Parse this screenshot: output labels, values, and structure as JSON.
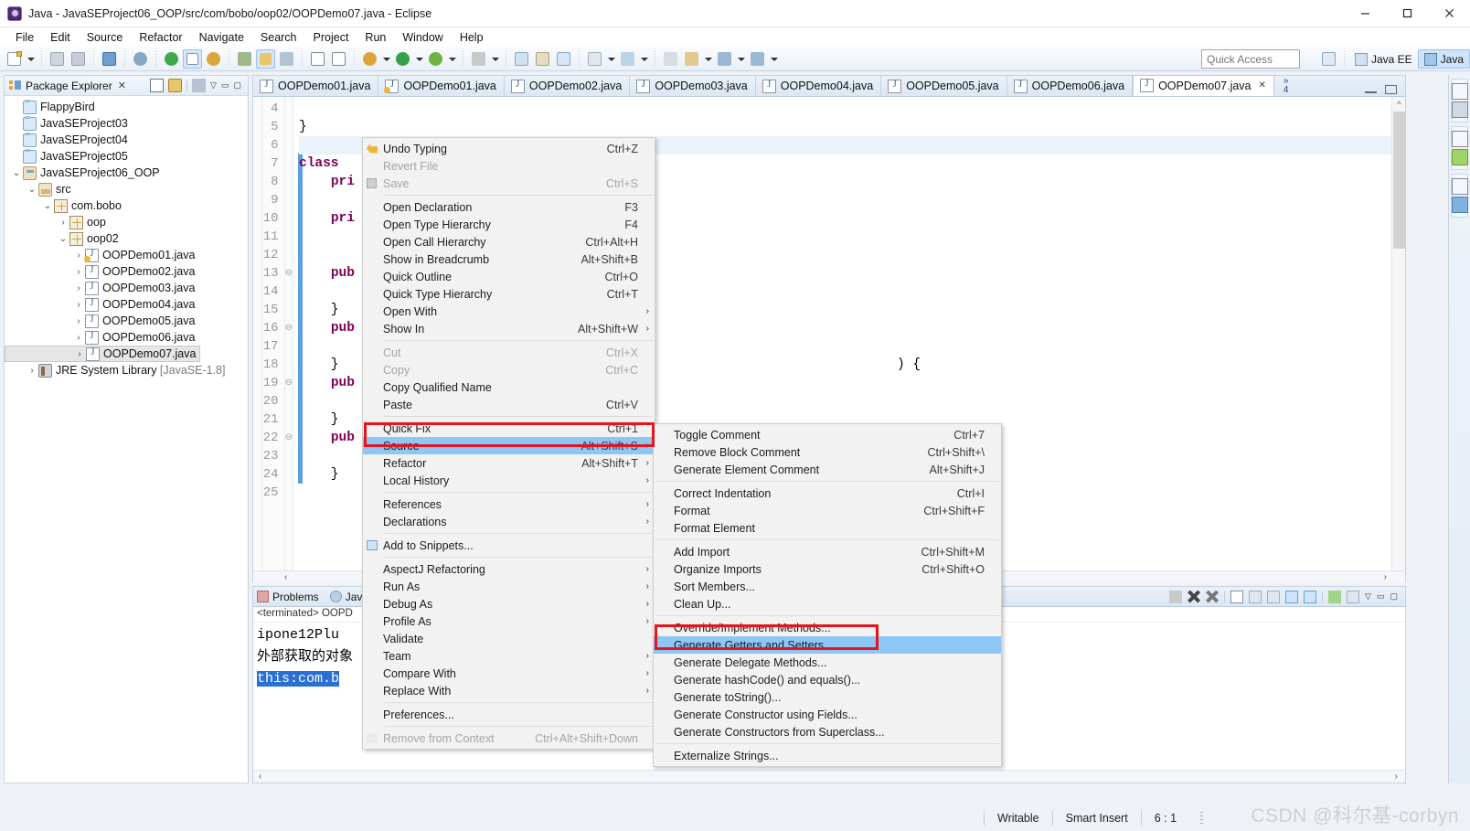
{
  "window": {
    "title": "Java - JavaSEProject06_OOP/src/com/bobo/oop02/OOPDemo07.java - Eclipse",
    "app_icon": "eclipse-icon",
    "minimize": "–",
    "maximize": "▢",
    "close": "✕"
  },
  "menubar": {
    "items": [
      "File",
      "Edit",
      "Source",
      "Refactor",
      "Navigate",
      "Search",
      "Project",
      "Run",
      "Window",
      "Help"
    ]
  },
  "toolbar": {
    "quick_access_placeholder": "Quick Access",
    "perspectives": [
      {
        "label": "Java EE",
        "selected": false
      },
      {
        "label": "Java",
        "selected": true
      }
    ]
  },
  "package_explorer": {
    "title": "Package Explorer",
    "close_glyph": "✕",
    "tools": [
      "collapse-all-icon",
      "link-with-editor-icon",
      "view-menu-icon",
      "minimize-icon",
      "maximize-icon"
    ],
    "tree": [
      {
        "label": "FlappyBird",
        "indent": 0,
        "twisty": "",
        "icon": "folder",
        "selected": false
      },
      {
        "label": "JavaSEProject03",
        "indent": 0,
        "twisty": "",
        "icon": "folder",
        "selected": false
      },
      {
        "label": "JavaSEProject04",
        "indent": 0,
        "twisty": "",
        "icon": "folder",
        "selected": false
      },
      {
        "label": "JavaSEProject05",
        "indent": 0,
        "twisty": "",
        "icon": "folder",
        "selected": false
      },
      {
        "label": "JavaSEProject06_OOP",
        "indent": 0,
        "twisty": "v",
        "icon": "project",
        "selected": false
      },
      {
        "label": "src",
        "indent": 1,
        "twisty": "v",
        "icon": "src",
        "selected": false
      },
      {
        "label": "com.bobo",
        "indent": 2,
        "twisty": "v",
        "icon": "pkg",
        "selected": false
      },
      {
        "label": "oop",
        "indent": 3,
        "twisty": ">",
        "icon": "pkg",
        "selected": false
      },
      {
        "label": "oop02",
        "indent": 3,
        "twisty": "v",
        "icon": "pkg",
        "selected": false
      },
      {
        "label": "OOPDemo01.java",
        "indent": 4,
        "twisty": ">",
        "icon": "java-warn",
        "selected": false
      },
      {
        "label": "OOPDemo02.java",
        "indent": 4,
        "twisty": ">",
        "icon": "java",
        "selected": false
      },
      {
        "label": "OOPDemo03.java",
        "indent": 4,
        "twisty": ">",
        "icon": "java",
        "selected": false
      },
      {
        "label": "OOPDemo04.java",
        "indent": 4,
        "twisty": ">",
        "icon": "java",
        "selected": false
      },
      {
        "label": "OOPDemo05.java",
        "indent": 4,
        "twisty": ">",
        "icon": "java",
        "selected": false
      },
      {
        "label": "OOPDemo06.java",
        "indent": 4,
        "twisty": ">",
        "icon": "java",
        "selected": false
      },
      {
        "label": "OOPDemo07.java",
        "indent": 4,
        "twisty": ">",
        "icon": "java",
        "selected": true
      },
      {
        "label": "JRE System Library [JavaSE-1.8]",
        "indent": 1,
        "twisty": ">",
        "icon": "library",
        "selected": false
      }
    ]
  },
  "editor": {
    "tabs": [
      {
        "label": "OOPDemo01.java",
        "icon": "java",
        "active": false,
        "dirty": false
      },
      {
        "label": "OOPDemo01.java",
        "icon": "java-warn",
        "active": false,
        "dirty": false
      },
      {
        "label": "OOPDemo02.java",
        "icon": "java",
        "active": false,
        "dirty": false
      },
      {
        "label": "OOPDemo03.java",
        "icon": "java",
        "active": false,
        "dirty": false
      },
      {
        "label": "OOPDemo04.java",
        "icon": "java",
        "active": false,
        "dirty": false
      },
      {
        "label": "OOPDemo05.java",
        "icon": "java",
        "active": false,
        "dirty": false
      },
      {
        "label": "OOPDemo06.java",
        "icon": "java",
        "active": false,
        "dirty": false
      },
      {
        "label": "OOPDemo07.java",
        "icon": "java",
        "active": true,
        "dirty": false
      }
    ],
    "active_tab_close": "✕",
    "overflow_chevron": "»",
    "overflow_count": "4",
    "minimize_tooltip": "Minimize",
    "maximize_tooltip": "Maximize",
    "lines": [
      {
        "no": "4",
        "fold": "",
        "text": ""
      },
      {
        "no": "5",
        "fold": "",
        "text": "}"
      },
      {
        "no": "6",
        "fold": "",
        "text": "",
        "current": true
      },
      {
        "no": "7",
        "fold": "",
        "text": "class P",
        "kw": "class"
      },
      {
        "no": "8",
        "fold": "",
        "text": "    pri",
        "kw": "pri"
      },
      {
        "no": "9",
        "fold": "",
        "text": ""
      },
      {
        "no": "10",
        "fold": "",
        "text": "    pri",
        "kw": "pri"
      },
      {
        "no": "11",
        "fold": "",
        "text": ""
      },
      {
        "no": "12",
        "fold": "",
        "text": ""
      },
      {
        "no": "13",
        "fold": "⊖",
        "text": "    pub",
        "kw": "pub"
      },
      {
        "no": "14",
        "fold": "",
        "text": ""
      },
      {
        "no": "15",
        "fold": "",
        "text": "    }"
      },
      {
        "no": "16",
        "fold": "⊖",
        "text": "    pub",
        "kw": "pub"
      },
      {
        "no": "17",
        "fold": "",
        "text": ""
      },
      {
        "no": "18",
        "fold": "",
        "text": "    }"
      },
      {
        "no": "19",
        "fold": "⊖",
        "text": "    pub",
        "kw": "pub"
      },
      {
        "no": "20",
        "fold": "",
        "text": ""
      },
      {
        "no": "21",
        "fold": "",
        "text": "    }"
      },
      {
        "no": "22",
        "fold": "⊖",
        "text": "    pub",
        "kw": "pub"
      },
      {
        "no": "23",
        "fold": "",
        "text": ""
      },
      {
        "no": "24",
        "fold": "",
        "text": "    }"
      },
      {
        "no": "25",
        "fold": "",
        "text": ""
      }
    ],
    "code_fragment_right": ") {",
    "scroll_up_glyph": "^",
    "scroll_down_glyph": "v",
    "hscroll_left_glyph": "‹",
    "hscroll_right_glyph": "›"
  },
  "console": {
    "tabs": [
      {
        "label": "Problems",
        "icon": "problems-icon",
        "active": false
      },
      {
        "label": "Javad",
        "icon": "javadoc-icon",
        "active": false
      }
    ],
    "terminated_line": "<terminated> OOPD",
    "output": [
      {
        "text": "ipone12Plu",
        "highlight": false
      },
      {
        "text": "外部获取的对象",
        "highlight": false
      },
      {
        "text": "this:com.b",
        "highlight": true
      }
    ],
    "tools": [
      "terminate-icon",
      "remove-launch-icon",
      "remove-all-icon",
      "open-console-icon",
      "display-selected-console-icon",
      "pin-console-icon",
      "scroll-lock-icon",
      "word-wrap-icon",
      "clear-console-icon",
      "view-menu-icon",
      "minimize-icon",
      "maximize-icon"
    ]
  },
  "statusbar": {
    "writable": "Writable",
    "insert_mode": "Smart Insert",
    "cursor_position": "6 : 1",
    "watermark": "CSDN @科尔基-corbyn"
  },
  "context_menu": {
    "items": [
      {
        "label": "Undo Typing",
        "accel": "Ctrl+Z",
        "icon": "undo-icon",
        "disabled": false,
        "submenu": false
      },
      {
        "label": "Revert File",
        "accel": "",
        "icon": "",
        "disabled": true,
        "submenu": false
      },
      {
        "label": "Save",
        "accel": "Ctrl+S",
        "icon": "save-icon",
        "disabled": true,
        "submenu": false
      },
      {
        "separator": true
      },
      {
        "label": "Open Declaration",
        "accel": "F3",
        "icon": "",
        "disabled": false,
        "submenu": false
      },
      {
        "label": "Open Type Hierarchy",
        "accel": "F4",
        "icon": "",
        "disabled": false,
        "submenu": false
      },
      {
        "label": "Open Call Hierarchy",
        "accel": "Ctrl+Alt+H",
        "icon": "",
        "disabled": false,
        "submenu": false
      },
      {
        "label": "Show in Breadcrumb",
        "accel": "Alt+Shift+B",
        "icon": "",
        "disabled": false,
        "submenu": false
      },
      {
        "label": "Quick Outline",
        "accel": "Ctrl+O",
        "icon": "",
        "disabled": false,
        "submenu": false
      },
      {
        "label": "Quick Type Hierarchy",
        "accel": "Ctrl+T",
        "icon": "",
        "disabled": false,
        "submenu": false
      },
      {
        "label": "Open With",
        "accel": "",
        "icon": "",
        "disabled": false,
        "submenu": true
      },
      {
        "label": "Show In",
        "accel": "Alt+Shift+W",
        "icon": "",
        "disabled": false,
        "submenu": true
      },
      {
        "separator": true
      },
      {
        "label": "Cut",
        "accel": "Ctrl+X",
        "icon": "",
        "disabled": true,
        "submenu": false
      },
      {
        "label": "Copy",
        "accel": "Ctrl+C",
        "icon": "",
        "disabled": true,
        "submenu": false
      },
      {
        "label": "Copy Qualified Name",
        "accel": "",
        "icon": "",
        "disabled": false,
        "submenu": false
      },
      {
        "label": "Paste",
        "accel": "Ctrl+V",
        "icon": "",
        "disabled": false,
        "submenu": false
      },
      {
        "separator": true
      },
      {
        "label": "Quick Fix",
        "accel": "Ctrl+1",
        "icon": "",
        "disabled": false,
        "submenu": false
      },
      {
        "label": "Source",
        "accel": "Alt+Shift+S",
        "icon": "",
        "disabled": false,
        "submenu": true,
        "selected": true,
        "highlighted_box": true
      },
      {
        "label": "Refactor",
        "accel": "Alt+Shift+T",
        "icon": "",
        "disabled": false,
        "submenu": true
      },
      {
        "label": "Local History",
        "accel": "",
        "icon": "",
        "disabled": false,
        "submenu": true
      },
      {
        "separator": true
      },
      {
        "label": "References",
        "accel": "",
        "icon": "",
        "disabled": false,
        "submenu": true
      },
      {
        "label": "Declarations",
        "accel": "",
        "icon": "",
        "disabled": false,
        "submenu": true
      },
      {
        "separator": true
      },
      {
        "label": "Add to Snippets...",
        "accel": "",
        "icon": "snippet-icon",
        "disabled": false,
        "submenu": false
      },
      {
        "separator": true
      },
      {
        "label": "AspectJ Refactoring",
        "accel": "",
        "icon": "",
        "disabled": false,
        "submenu": true
      },
      {
        "label": "Run As",
        "accel": "",
        "icon": "",
        "disabled": false,
        "submenu": true
      },
      {
        "label": "Debug As",
        "accel": "",
        "icon": "",
        "disabled": false,
        "submenu": true
      },
      {
        "label": "Profile As",
        "accel": "",
        "icon": "",
        "disabled": false,
        "submenu": true
      },
      {
        "label": "Validate",
        "accel": "",
        "icon": "",
        "disabled": false,
        "submenu": false
      },
      {
        "label": "Team",
        "accel": "",
        "icon": "",
        "disabled": false,
        "submenu": true
      },
      {
        "label": "Compare With",
        "accel": "",
        "icon": "",
        "disabled": false,
        "submenu": true
      },
      {
        "label": "Replace With",
        "accel": "",
        "icon": "",
        "disabled": false,
        "submenu": true
      },
      {
        "separator": true
      },
      {
        "label": "Preferences...",
        "accel": "",
        "icon": "",
        "disabled": false,
        "submenu": false
      },
      {
        "separator": true
      },
      {
        "label": "Remove from Context",
        "accel": "Ctrl+Alt+Shift+Down",
        "icon": "remove-context-icon",
        "disabled": true,
        "submenu": false
      }
    ]
  },
  "source_submenu": {
    "items": [
      {
        "label": "Toggle Comment",
        "accel": "Ctrl+7"
      },
      {
        "label": "Remove Block Comment",
        "accel": "Ctrl+Shift+\\"
      },
      {
        "label": "Generate Element Comment",
        "accel": "Alt+Shift+J"
      },
      {
        "separator": true
      },
      {
        "label": "Correct Indentation",
        "accel": "Ctrl+I"
      },
      {
        "label": "Format",
        "accel": "Ctrl+Shift+F"
      },
      {
        "label": "Format Element",
        "accel": ""
      },
      {
        "separator": true
      },
      {
        "label": "Add Import",
        "accel": "Ctrl+Shift+M"
      },
      {
        "label": "Organize Imports",
        "accel": "Ctrl+Shift+O"
      },
      {
        "label": "Sort Members...",
        "accel": ""
      },
      {
        "label": "Clean Up...",
        "accel": ""
      },
      {
        "separator": true
      },
      {
        "label": "Override/Implement Methods...",
        "accel": ""
      },
      {
        "label": "Generate Getters and Setters...",
        "accel": "",
        "selected": true,
        "highlighted_box": true
      },
      {
        "label": "Generate Delegate Methods...",
        "accel": ""
      },
      {
        "label": "Generate hashCode() and equals()...",
        "accel": ""
      },
      {
        "label": "Generate toString()...",
        "accel": ""
      },
      {
        "label": "Generate Constructor using Fields...",
        "accel": ""
      },
      {
        "label": "Generate Constructors from Superclass...",
        "accel": ""
      },
      {
        "separator": true
      },
      {
        "label": "Externalize Strings...",
        "accel": ""
      }
    ]
  },
  "colors": {
    "menu_highlight": "#8ec6f5",
    "red_box": "#e8141c",
    "keyword": "#7f0055",
    "selection": "#2a6fd6",
    "accent": "#cfe4fa"
  }
}
